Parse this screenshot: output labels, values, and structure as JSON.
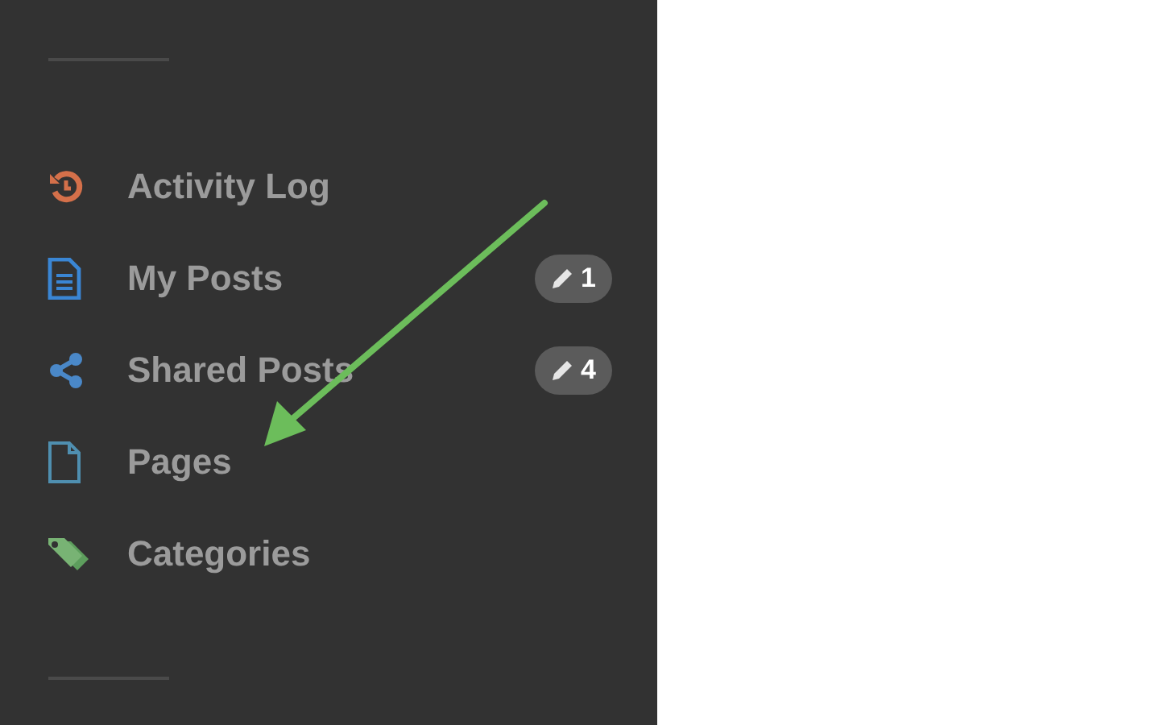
{
  "sidebar": {
    "items": [
      {
        "label": "Activity Log"
      },
      {
        "label": "My Posts",
        "badge": "1"
      },
      {
        "label": "Shared Posts",
        "badge": "4"
      },
      {
        "label": "Pages"
      },
      {
        "label": "Categories"
      }
    ]
  }
}
